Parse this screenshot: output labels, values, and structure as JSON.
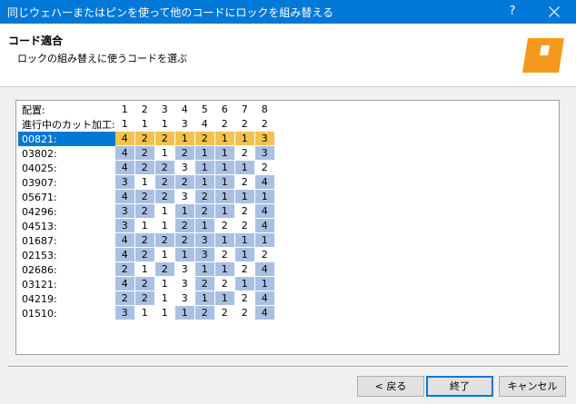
{
  "window": {
    "title": "同じウェハーまたはピンを使って他のコードにロックを組み替える",
    "help": "?"
  },
  "header": {
    "title": "コード適合",
    "subtitle": "ロックの組み替えに使うコードを選ぶ"
  },
  "colors": {
    "titlebar": "#0078d7",
    "cell_highlight": "#a9c0e3",
    "selected_row": "#f2c34c",
    "logo": "#f39a1e"
  },
  "table": {
    "position_label": "配置:",
    "positions": [
      "1",
      "2",
      "3",
      "4",
      "5",
      "6",
      "7",
      "8"
    ],
    "current_cut_label": "進行中のカット加工:",
    "current_cuts": [
      "1",
      "1",
      "1",
      "3",
      "4",
      "2",
      "2",
      "2"
    ],
    "selected_index": 0,
    "rows": [
      {
        "code": "00821:",
        "values": [
          "4",
          "2",
          "2",
          "1",
          "2",
          "1",
          "1",
          "3"
        ]
      },
      {
        "code": "03802:",
        "values": [
          "4",
          "2",
          "1",
          "2",
          "1",
          "1",
          "2",
          "3"
        ]
      },
      {
        "code": "04025:",
        "values": [
          "4",
          "2",
          "2",
          "3",
          "1",
          "1",
          "1",
          "2"
        ]
      },
      {
        "code": "03907:",
        "values": [
          "3",
          "1",
          "2",
          "2",
          "1",
          "1",
          "2",
          "4"
        ]
      },
      {
        "code": "05671:",
        "values": [
          "4",
          "2",
          "2",
          "3",
          "2",
          "1",
          "1",
          "1"
        ]
      },
      {
        "code": "04296:",
        "values": [
          "3",
          "2",
          "1",
          "1",
          "2",
          "1",
          "2",
          "4"
        ]
      },
      {
        "code": "04513:",
        "values": [
          "3",
          "1",
          "1",
          "2",
          "1",
          "2",
          "2",
          "4"
        ]
      },
      {
        "code": "01687:",
        "values": [
          "4",
          "2",
          "2",
          "2",
          "3",
          "1",
          "1",
          "1"
        ]
      },
      {
        "code": "02153:",
        "values": [
          "4",
          "2",
          "1",
          "1",
          "3",
          "2",
          "1",
          "2"
        ]
      },
      {
        "code": "02686:",
        "values": [
          "2",
          "1",
          "2",
          "3",
          "1",
          "1",
          "2",
          "4"
        ]
      },
      {
        "code": "03121:",
        "values": [
          "4",
          "2",
          "1",
          "3",
          "2",
          "2",
          "1",
          "1"
        ]
      },
      {
        "code": "04219:",
        "values": [
          "2",
          "2",
          "1",
          "3",
          "1",
          "1",
          "2",
          "4"
        ]
      },
      {
        "code": "01510:",
        "values": [
          "3",
          "1",
          "1",
          "1",
          "2",
          "2",
          "2",
          "4"
        ]
      }
    ]
  },
  "buttons": {
    "back": "< 戻る",
    "finish": "終了",
    "cancel": "キャンセル"
  }
}
